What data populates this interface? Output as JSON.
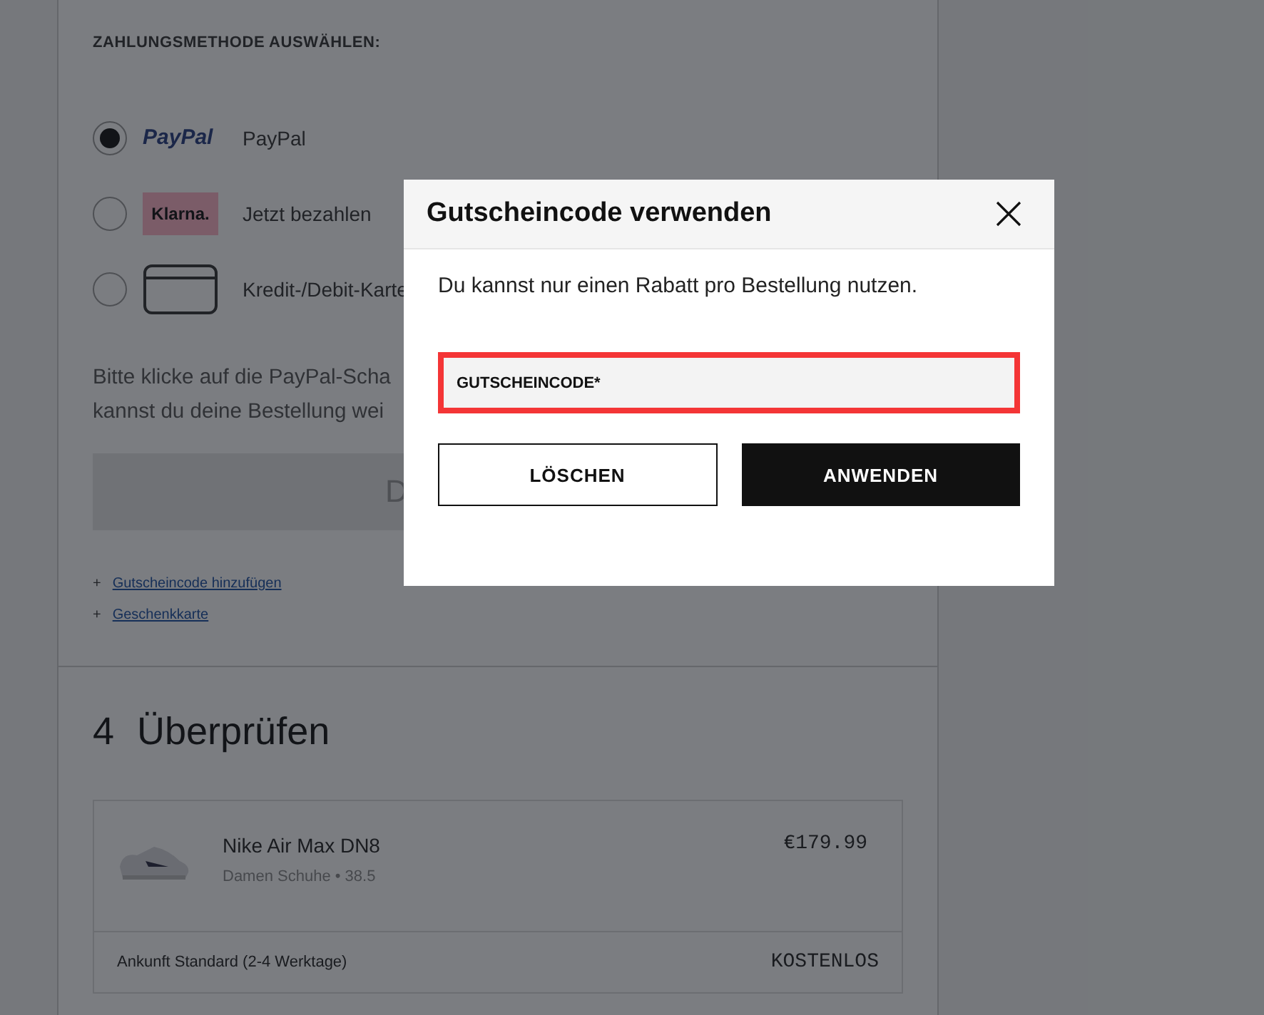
{
  "payment": {
    "heading": "ZAHLUNGSMETHODE AUSWÄHLEN:",
    "methods": [
      {
        "kind": "paypal",
        "logo": "PayPal",
        "label": "PayPal",
        "selected": true
      },
      {
        "kind": "klarna",
        "logo": "Klarna.",
        "label": "Jetzt bezahlen",
        "selected": false
      },
      {
        "kind": "card",
        "label": "Kredit-/Debit-Karte",
        "selected": false
      }
    ],
    "hint_lines": [
      "Bitte klicke auf die PayPal-Scha",
      "kannst du deine Bestellung wei"
    ],
    "button": "D",
    "links": [
      {
        "icon": "+",
        "label": "Gutscheincode hinzufügen"
      },
      {
        "icon": "+",
        "label": "Geschenkkarte"
      }
    ]
  },
  "review": {
    "number": "4",
    "title": "Überprüfen",
    "item": {
      "name": "Nike Air Max DN8",
      "details": "Damen Schuhe • 38.5",
      "price": "€179.99"
    },
    "shipping": {
      "label": "Ankunft Standard (2-4 Werktage)",
      "price": "KOSTENLOS"
    }
  },
  "dialog": {
    "title": "Gutscheincode verwenden",
    "text": "Du kannst nur einen Rabatt pro Bestellung nutzen.",
    "field": {
      "placeholder": "GUTSCHEINCODE*",
      "error": true
    },
    "buttons": [
      {
        "kind": "secondary",
        "label": "LÖSCHEN"
      },
      {
        "kind": "primary",
        "label": "ANWENDEN"
      }
    ]
  }
}
